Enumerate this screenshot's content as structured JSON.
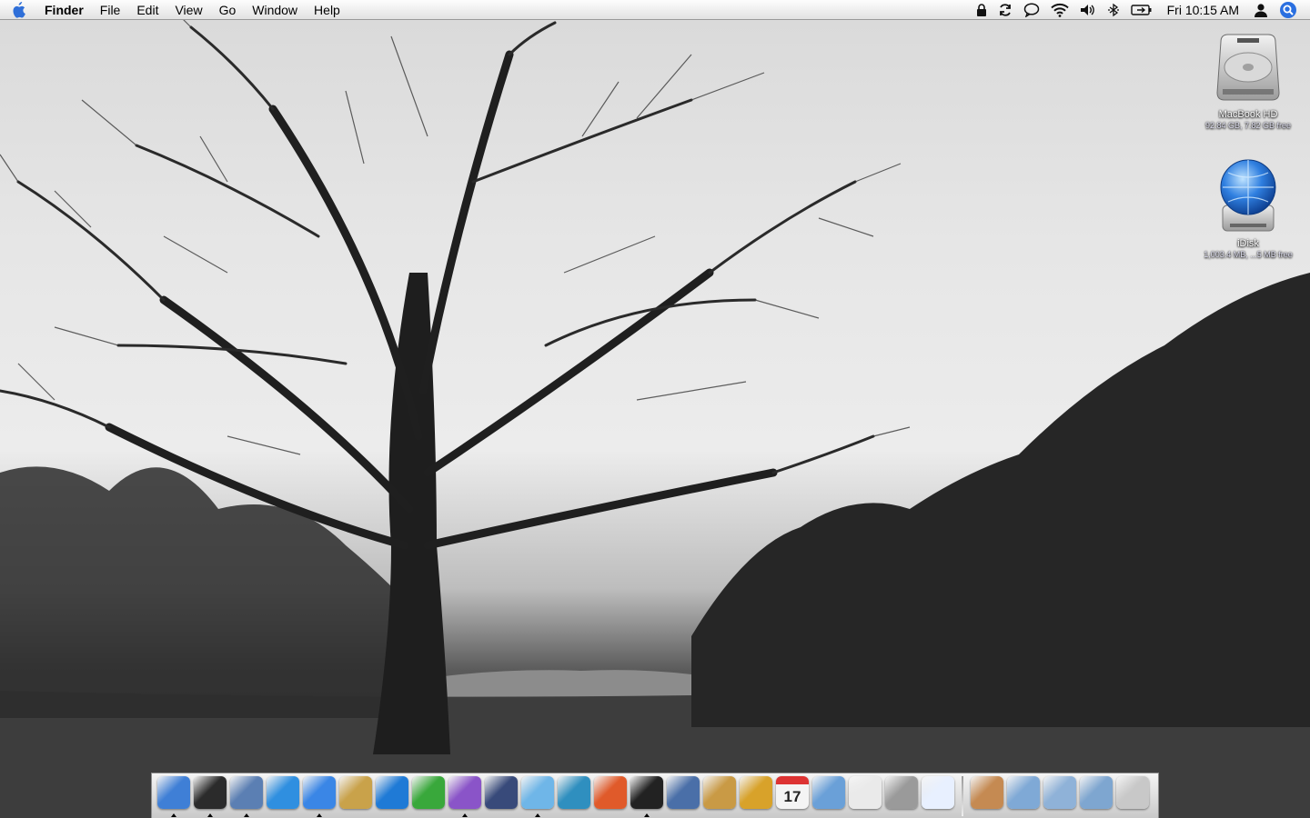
{
  "menubar": {
    "app_name": "Finder",
    "menus": [
      "File",
      "Edit",
      "View",
      "Go",
      "Window",
      "Help"
    ],
    "clock": "Fri 10:15 AM",
    "status_icons": [
      "lock-icon",
      "sync-icon",
      "chat-icon",
      "wifi-icon",
      "volume-icon",
      "bluetooth-icon",
      "battery-icon",
      "user-icon",
      "spotlight-icon"
    ]
  },
  "desktop": {
    "icons": [
      {
        "name": "MacBook HD",
        "info": "92.84 GB, 7.82 GB free"
      },
      {
        "name": "iDisk",
        "info": "1,003.4 MB, ...5 MB free"
      }
    ]
  },
  "dock": {
    "apps": [
      {
        "icon": "finder-icon",
        "color": "#3f7fd6",
        "running": true
      },
      {
        "icon": "dashboard-icon",
        "color": "#2b2b2b",
        "running": true
      },
      {
        "icon": "mail-stamp-icon",
        "color": "#5b7fb3",
        "running": true
      },
      {
        "icon": "safari-icon",
        "color": "#2f8fe0",
        "running": false
      },
      {
        "icon": "ichat-icon",
        "color": "#3a86e6",
        "running": true
      },
      {
        "icon": "address-book-icon",
        "color": "#c9a24a",
        "running": false
      },
      {
        "icon": "textwrangler-icon",
        "color": "#1f7ad6",
        "running": false
      },
      {
        "icon": "network-icon",
        "color": "#39a83b",
        "running": false
      },
      {
        "icon": "purple-app-icon",
        "color": "#8a54c8",
        "running": true
      },
      {
        "icon": "quill-app-icon",
        "color": "#384a7a",
        "running": false
      },
      {
        "icon": "itunes-icon",
        "color": "#6fb6e8",
        "running": true
      },
      {
        "icon": "feather-app-icon",
        "color": "#2f8fbf",
        "running": false
      },
      {
        "icon": "flame-app-icon",
        "color": "#e05a2a",
        "running": false
      },
      {
        "icon": "camera-icon",
        "color": "#222222",
        "running": true
      },
      {
        "icon": "iphoto-icon",
        "color": "#4a6fa8",
        "running": false
      },
      {
        "icon": "preview-icon",
        "color": "#c99a45",
        "running": false
      },
      {
        "icon": "delivery-truck-icon",
        "color": "#d8a22a",
        "running": false
      },
      {
        "icon": "ical-icon",
        "color": "#eeeeee",
        "running": false
      },
      {
        "icon": "mailbox-icon",
        "color": "#6aa0d8",
        "running": false
      },
      {
        "icon": "textedit-icon",
        "color": "#eaeaea",
        "running": false
      },
      {
        "icon": "calculator-icon",
        "color": "#9a9a9a",
        "running": false
      },
      {
        "icon": "windows-icon",
        "color": "#e8f0ff",
        "running": false
      }
    ],
    "folders": [
      {
        "icon": "home-folder-icon",
        "color": "#c58a52"
      },
      {
        "icon": "applications-folder-icon",
        "color": "#7fa9d6"
      },
      {
        "icon": "documents-folder-icon",
        "color": "#8fb2d8"
      },
      {
        "icon": "downloads-folder-icon",
        "color": "#7ea6d0"
      },
      {
        "icon": "trash-icon",
        "color": "#c8c8c8"
      }
    ],
    "ical_date": "17"
  }
}
